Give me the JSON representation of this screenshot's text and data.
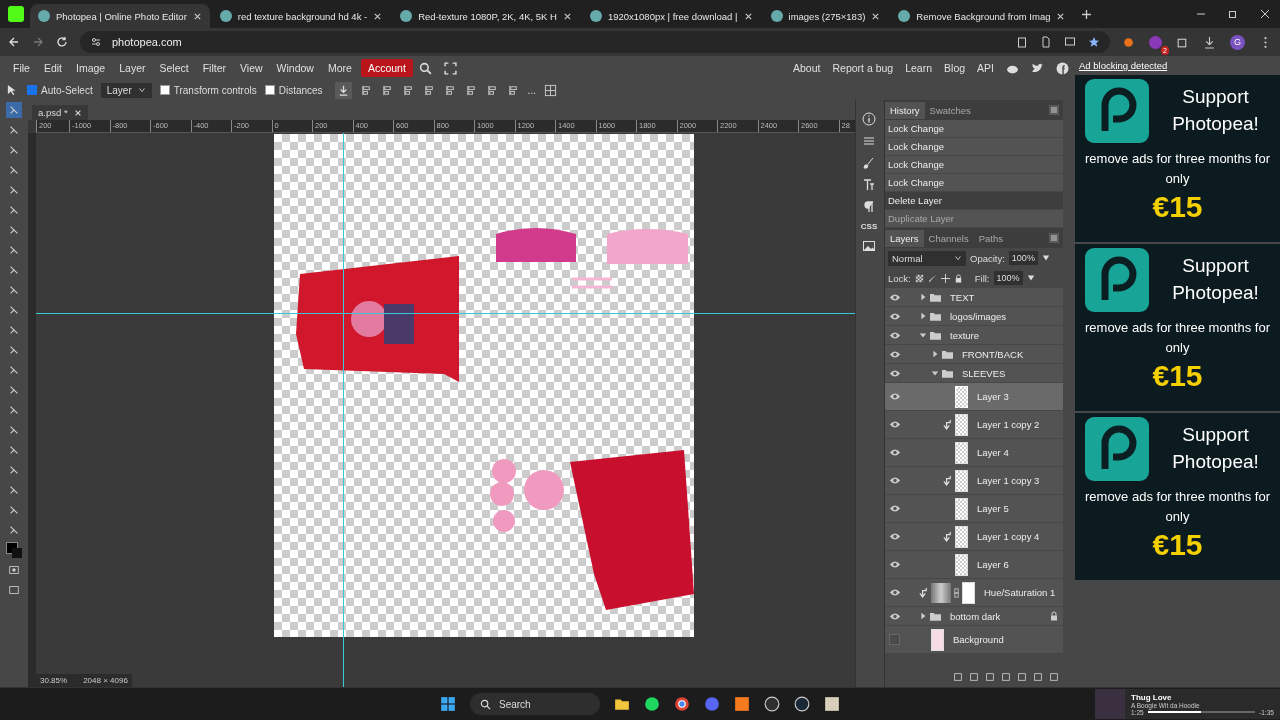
{
  "browser": {
    "tabs": [
      {
        "title": "Photopea | Online Photo Editor",
        "selected": true
      },
      {
        "title": "red texture background hd 4k -",
        "selected": false
      },
      {
        "title": "Red-texture 1080P, 2K, 4K, 5K H",
        "selected": false
      },
      {
        "title": "1920x1080px | free download |",
        "selected": false
      },
      {
        "title": "images (275×183)",
        "selected": false
      },
      {
        "title": "Remove Background from Imag",
        "selected": false
      }
    ],
    "url": "photopea.com",
    "notifications": "2",
    "profile": "G"
  },
  "menu": {
    "items": [
      "File",
      "Edit",
      "Image",
      "Layer",
      "Select",
      "Filter",
      "View",
      "Window",
      "More"
    ],
    "account": "Account",
    "links": [
      "About",
      "Report a bug",
      "Learn",
      "Blog",
      "API"
    ]
  },
  "options": {
    "auto_select": {
      "label": "Auto-Select",
      "checked": true
    },
    "select_mode": "Layer",
    "transform_controls": {
      "label": "Transform controls",
      "checked": false
    },
    "distances": {
      "label": "Distances",
      "checked": false
    },
    "more": "..."
  },
  "document_tab": "a.psd *",
  "ruler_labels": [
    "200",
    "-1000",
    "-800",
    "-600",
    "-400",
    "-200",
    "0",
    "200",
    "400",
    "600",
    "800",
    "1000",
    "1200",
    "1400",
    "1600",
    "1800",
    "2000",
    "2200",
    "2400",
    "2600",
    "28"
  ],
  "side_strip": {
    "css_label": "CSS"
  },
  "history": {
    "tabs": [
      {
        "label": "History",
        "selected": true
      },
      {
        "label": "Swatches",
        "selected": false
      }
    ],
    "items": [
      {
        "label": "Lock Change",
        "selected": false,
        "disabled": false
      },
      {
        "label": "Lock Change",
        "selected": false,
        "disabled": false
      },
      {
        "label": "Lock Change",
        "selected": false,
        "disabled": false
      },
      {
        "label": "Lock Change",
        "selected": false,
        "disabled": false
      },
      {
        "label": "Delete Layer",
        "selected": true,
        "disabled": false
      },
      {
        "label": "Duplicate Layer",
        "selected": false,
        "disabled": true
      }
    ]
  },
  "layers_panel": {
    "tabs": [
      {
        "label": "Layers",
        "selected": true
      },
      {
        "label": "Channels",
        "selected": false
      },
      {
        "label": "Paths",
        "selected": false
      }
    ],
    "blend_mode": "Normal",
    "opacity_label": "Opacity:",
    "opacity": "100%",
    "lock_label": "Lock:",
    "fill_label": "Fill:",
    "fill": "100%",
    "layers": [
      {
        "name": "TEXT",
        "kind": "folder",
        "visible": true,
        "expanded": false,
        "selected": false,
        "locked": false
      },
      {
        "name": "logos/images",
        "kind": "folder",
        "visible": true,
        "expanded": false,
        "selected": false,
        "locked": false
      },
      {
        "name": "texture",
        "kind": "folder",
        "visible": true,
        "expanded": true,
        "selected": false,
        "locked": false,
        "children": [
          {
            "name": "FRONT/BACK",
            "kind": "folder",
            "visible": true,
            "expanded": false,
            "selected": false,
            "locked": false
          },
          {
            "name": "SLEEVES",
            "kind": "folder",
            "visible": true,
            "expanded": true,
            "selected": false,
            "locked": false,
            "children": [
              {
                "name": "Layer 3",
                "kind": "layer",
                "visible": true,
                "selected": true,
                "clipped": false,
                "locked": false
              },
              {
                "name": "Layer 1 copy 2",
                "kind": "layer",
                "visible": true,
                "selected": false,
                "clipped": true,
                "locked": false
              },
              {
                "name": "Layer 4",
                "kind": "layer",
                "visible": true,
                "selected": false,
                "clipped": false,
                "locked": false
              },
              {
                "name": "Layer 1 copy 3",
                "kind": "layer",
                "visible": true,
                "selected": false,
                "clipped": true,
                "locked": false
              },
              {
                "name": "Layer 5",
                "kind": "layer",
                "visible": true,
                "selected": false,
                "clipped": false,
                "locked": false
              },
              {
                "name": "Layer 1 copy 4",
                "kind": "layer",
                "visible": true,
                "selected": false,
                "clipped": true,
                "locked": false
              },
              {
                "name": "Layer 6",
                "kind": "layer",
                "visible": true,
                "selected": false,
                "clipped": false,
                "locked": false
              }
            ]
          }
        ]
      },
      {
        "name": "Hue/Saturation 1",
        "kind": "adjustment",
        "visible": true,
        "selected": false,
        "clipped": true,
        "locked": false
      },
      {
        "name": "bottom dark",
        "kind": "folder",
        "visible": true,
        "expanded": false,
        "selected": false,
        "locked": true
      },
      {
        "name": "Background",
        "kind": "image",
        "visible": false,
        "selected": false,
        "clipped": false,
        "locked": false
      }
    ]
  },
  "status": {
    "zoom": "30.85%",
    "size": "2048 × 4096"
  },
  "ad": {
    "notice": "Ad blocking detected",
    "cards": [
      {
        "title": "Support Photopea!",
        "text": "remove ads for three months for only",
        "price": "€15"
      },
      {
        "title": "Support Photopea!",
        "text": "remove ads for three months for only",
        "price": "€15"
      },
      {
        "title": "Support Photopea!",
        "text": "remove ads for three months for only",
        "price": "€15"
      }
    ]
  },
  "taskbar": {
    "search": "Search",
    "media": {
      "title": "Thug Love",
      "artist": "A Boogie Wit da Hoodie",
      "elapsed": "1:25",
      "remaining": "-1:35",
      "level": 0.5
    }
  }
}
